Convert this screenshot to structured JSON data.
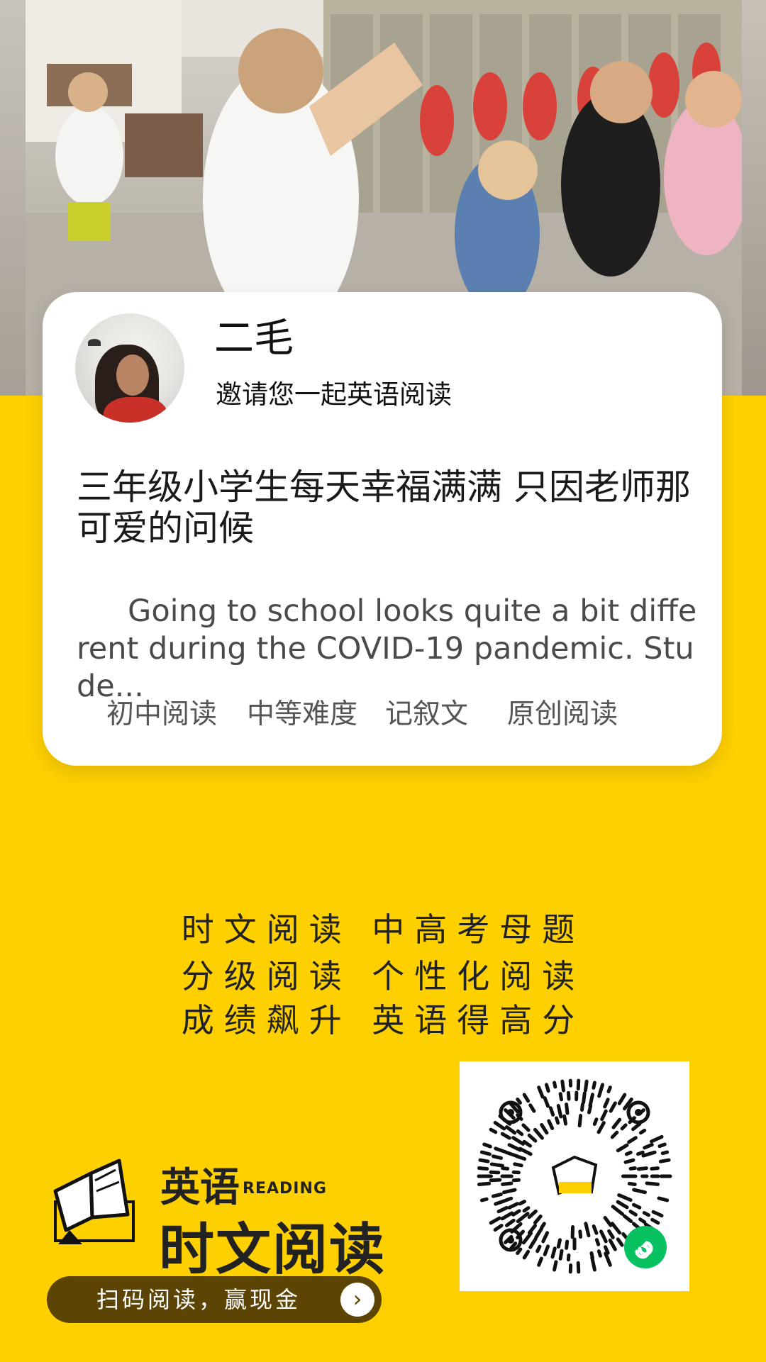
{
  "colors": {
    "background": "#ffd000",
    "card": "#ffffff",
    "button": "#5c4405",
    "wechat_green": "#07c160"
  },
  "profile": {
    "name": "二毛",
    "invite": "邀请您一起英语阅读"
  },
  "article": {
    "title": "三年级小学生每天幸福满满 只因老师那可爱的问候",
    "summary": "Going to school looks quite a bit different during the COVID-19 pandemic. Stude...",
    "tags": [
      "初中阅读",
      "中等难度",
      "记叙文",
      "原创阅读"
    ]
  },
  "slogan": {
    "lines": [
      "时文阅读 中高考母题",
      "分级阅读 个性化阅读",
      "成绩飙升 英语得高分"
    ]
  },
  "brand": {
    "line1": "英语",
    "reading": "READING",
    "line2": "时文阅读"
  },
  "cta": {
    "label": "扫码阅读，赢现金",
    "icon": "chevron-right-icon"
  },
  "qr": {
    "icon": "wechat-miniprogram-icon"
  }
}
